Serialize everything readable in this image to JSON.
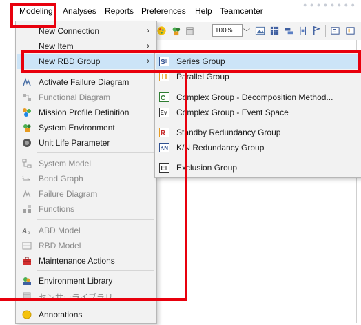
{
  "menubar": {
    "items": [
      "Modeling",
      "Analyses",
      "Reports",
      "Preferences",
      "Help",
      "Teamcenter"
    ],
    "dots": "● ● ● ● ● ● ● ●"
  },
  "toolbar": {
    "zoom": "100%"
  },
  "modeling_menu": {
    "items": [
      {
        "label": "New Connection",
        "icon": "none",
        "submenu": true
      },
      {
        "label": "New Item",
        "icon": "none",
        "submenu": true
      },
      {
        "label": "New RBD Group",
        "icon": "none",
        "submenu": true,
        "highlighted": true
      },
      {
        "label": "Activate Failure Diagram",
        "icon": "failure-diagram-icon"
      },
      {
        "label": "Functional Diagram",
        "icon": "functional-diagram-icon",
        "disabled": true
      },
      {
        "label": "Mission Profile Definition",
        "icon": "mission-profile-icon"
      },
      {
        "label": "System Environment",
        "icon": "system-environment-icon"
      },
      {
        "label": "Unit Life Parameter",
        "icon": "unit-life-icon"
      },
      {
        "label": "System Model",
        "icon": "system-model-icon",
        "disabled": true
      },
      {
        "label": "Bond Graph",
        "icon": "bond-graph-icon",
        "disabled": true
      },
      {
        "label": "Failure Diagram",
        "icon": "failure-diagram-icon",
        "disabled": true
      },
      {
        "label": "Functions",
        "icon": "functions-icon",
        "disabled": true
      },
      {
        "label": "ABD Model",
        "icon": "abd-model-icon",
        "disabled": true
      },
      {
        "label": "RBD Model",
        "icon": "rbd-model-icon",
        "disabled": true
      },
      {
        "label": "Maintenance Actions",
        "icon": "toolbox-icon"
      },
      {
        "label": "Environment Library",
        "icon": "environment-library-icon"
      },
      {
        "label": "センサーライブラリ",
        "icon": "sensor-library-icon",
        "disabled": true
      },
      {
        "label": "Annotations",
        "icon": "annotations-icon"
      }
    ]
  },
  "rbd_submenu": {
    "items": [
      {
        "label": "Series Group",
        "icon": "series-group-icon",
        "highlighted": true
      },
      {
        "label": "Parallel Group",
        "icon": "parallel-group-icon"
      },
      {
        "label": "Complex Group - Decomposition Method...",
        "icon": "complex-decomposition-icon"
      },
      {
        "label": "Complex Group - Event Space",
        "icon": "event-space-icon"
      },
      {
        "label": "Standby Redundancy Group",
        "icon": "standby-redundancy-icon"
      },
      {
        "label": "K/N Redundancy Group",
        "icon": "kn-redundancy-icon"
      },
      {
        "label": "Exclusion Group",
        "icon": "exclusion-group-icon"
      }
    ]
  },
  "colors": {
    "highlight": "#cce4f7",
    "annotation": "#e8000d",
    "menu_bg": "#f2f2f2"
  }
}
